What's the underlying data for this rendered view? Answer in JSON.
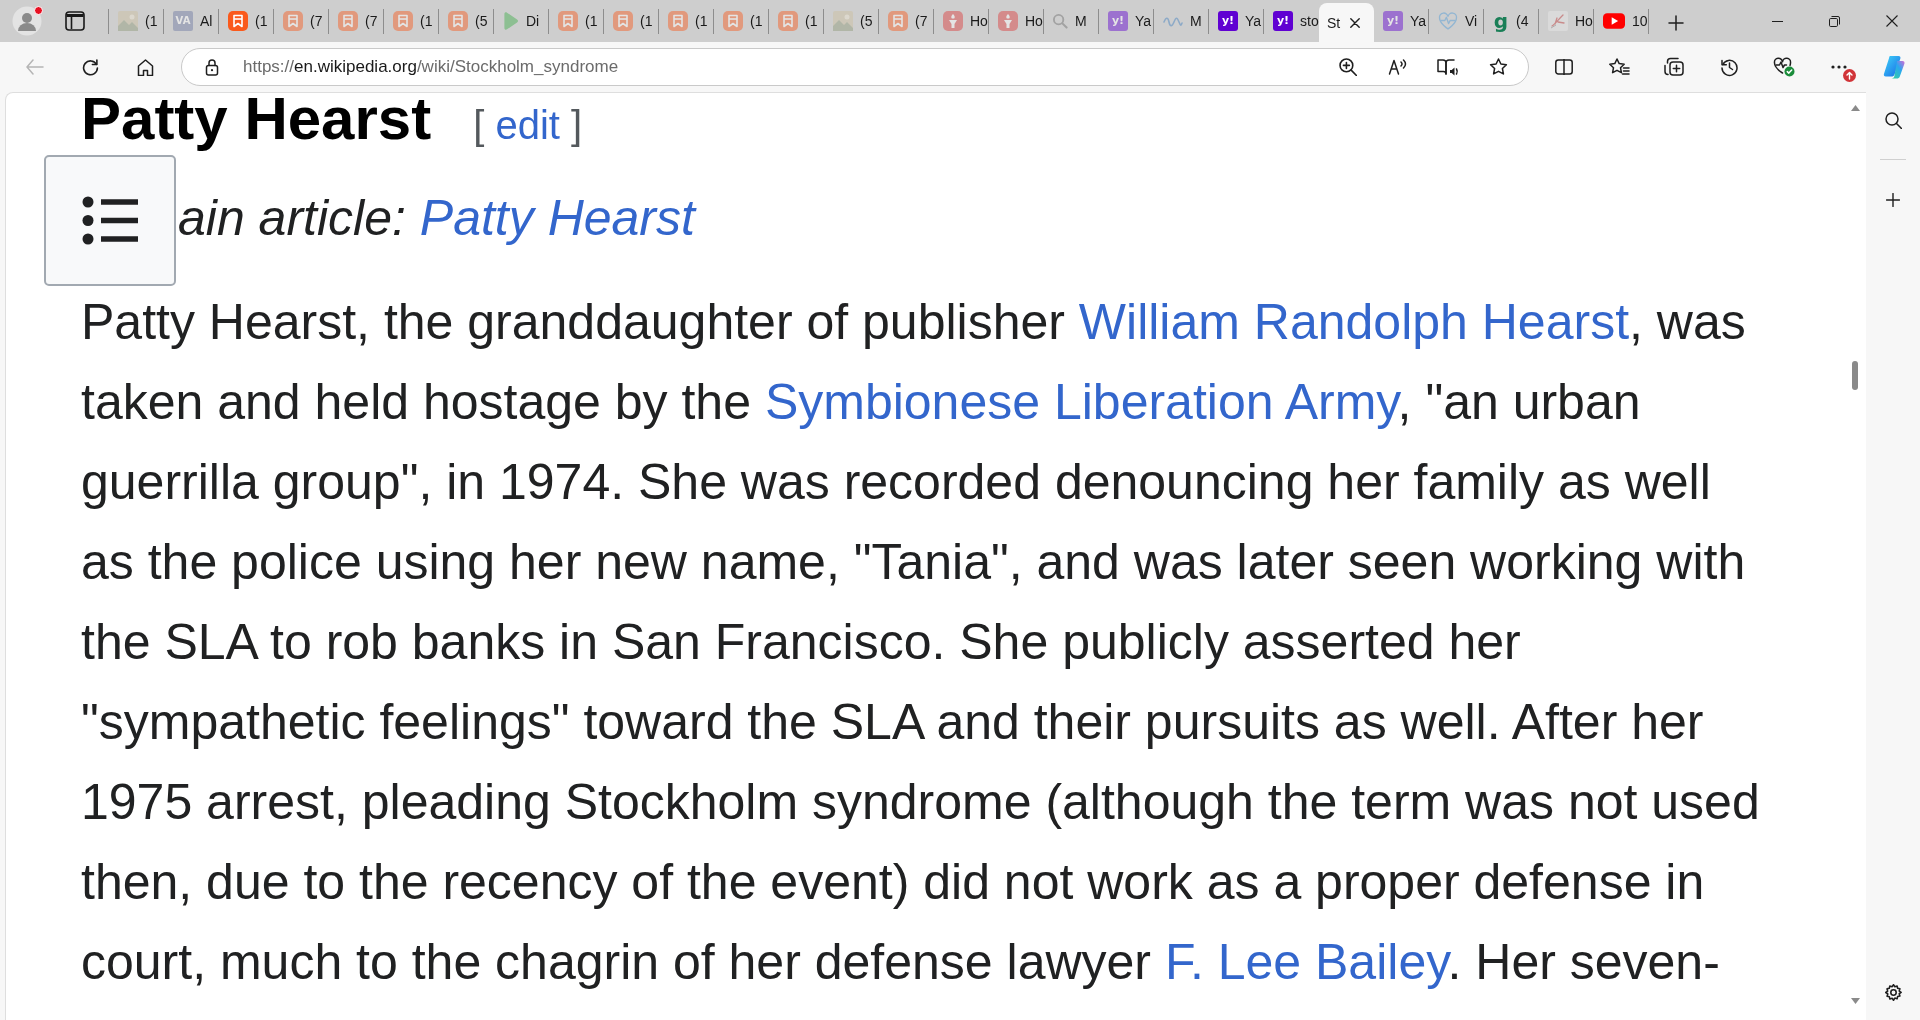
{
  "browser": {
    "profile_alert": true,
    "tabs": [
      {
        "title": "(1",
        "kind": "photo",
        "sleeping": true,
        "selected": false
      },
      {
        "title": "Al",
        "kind": "monogram",
        "icon_text": "VA",
        "sleeping": true,
        "selected": false
      },
      {
        "title": "(1",
        "kind": "bookmark",
        "sleeping": false,
        "selected": false
      },
      {
        "title": "(7",
        "kind": "bookmark",
        "sleeping": true,
        "selected": false
      },
      {
        "title": "(7",
        "kind": "bookmark",
        "sleeping": true,
        "selected": false
      },
      {
        "title": "(1",
        "kind": "bookmark",
        "sleeping": true,
        "selected": false
      },
      {
        "title": "(5",
        "kind": "bookmark",
        "sleeping": true,
        "selected": false
      },
      {
        "title": "Di",
        "kind": "play",
        "sleeping": true,
        "selected": false
      },
      {
        "title": "(1",
        "kind": "bookmark",
        "sleeping": true,
        "selected": false
      },
      {
        "title": "(1",
        "kind": "bookmark",
        "sleeping": true,
        "selected": false
      },
      {
        "title": "(1",
        "kind": "bookmark",
        "sleeping": true,
        "selected": false
      },
      {
        "title": "(1",
        "kind": "bookmark",
        "sleeping": true,
        "selected": false
      },
      {
        "title": "(1",
        "kind": "bookmark",
        "sleeping": true,
        "selected": false
      },
      {
        "title": "(5",
        "kind": "photo",
        "sleeping": true,
        "selected": false
      },
      {
        "title": "(7",
        "kind": "bookmark",
        "sleeping": true,
        "selected": false
      },
      {
        "title": "Ho",
        "kind": "torch",
        "sleeping": true,
        "selected": false
      },
      {
        "title": "Ho",
        "kind": "torch",
        "sleeping": true,
        "selected": false
      },
      {
        "title": "M",
        "kind": "search",
        "sleeping": true,
        "selected": false
      },
      {
        "title": "Ya",
        "kind": "badge",
        "icon_text": "y!",
        "sleeping": true,
        "selected": false
      },
      {
        "title": "M",
        "kind": "wave",
        "sleeping": true,
        "selected": false
      },
      {
        "title": "Ya",
        "kind": "badge",
        "icon_text": "y!",
        "sleeping": false,
        "selected": false
      },
      {
        "title": "sto",
        "kind": "badge",
        "icon_text": "y!",
        "sleeping": false,
        "selected": false
      },
      {
        "title": "St",
        "selected": true
      },
      {
        "title": "Ya",
        "kind": "badge",
        "icon_text": "y!",
        "sleeping": true,
        "selected": false
      },
      {
        "title": "Vi",
        "kind": "pulse",
        "sleeping": true,
        "selected": false
      },
      {
        "title": "(4",
        "kind": "letter",
        "icon_text": "g",
        "sleeping": true,
        "selected": false
      },
      {
        "title": "Ho",
        "kind": "sketch",
        "sleeping": true,
        "selected": false
      },
      {
        "title": "10",
        "kind": "video",
        "sleeping": false,
        "selected": false
      }
    ],
    "back_disabled": true,
    "address": {
      "scheme": "https://",
      "host": "en.wikipedia.org",
      "path": "/wiki/Stockholm_syndrome"
    },
    "update_alert": true
  },
  "article": {
    "heading": "Patty Hearst",
    "edit": {
      "open": "[",
      "label": "edit",
      "close": "]"
    },
    "hatnote": {
      "prefix": "ain article:",
      "link": "Patty Hearst"
    },
    "paragraph": [
      {
        "kind": "text",
        "text": "Patty Hearst, the granddaughter of publisher "
      },
      {
        "kind": "link",
        "text": "William Randolph Hearst"
      },
      {
        "kind": "text",
        "text": ", was taken and held hostage by the "
      },
      {
        "kind": "link",
        "text": "Symbionese Liberation Army"
      },
      {
        "kind": "text",
        "text": ", \"an urban guerrilla group\", in 1974. She was recorded denouncing her family as well as the police using her new name, \"Tania\", and was later seen working with the SLA to rob banks in San Francisco. She publicly asserted her \"sympathetic feelings\" toward the SLA and their pursuits as well. After her 1975 arrest, pleading Stockholm syndrome (although the term was not used then, due to the recency of the event) did not work as a proper defense in court, much to the chagrin of her defense lawyer "
      },
      {
        "kind": "link",
        "text": "F. Lee Bailey"
      },
      {
        "kind": "text",
        "text": ". Her seven-"
      }
    ]
  }
}
